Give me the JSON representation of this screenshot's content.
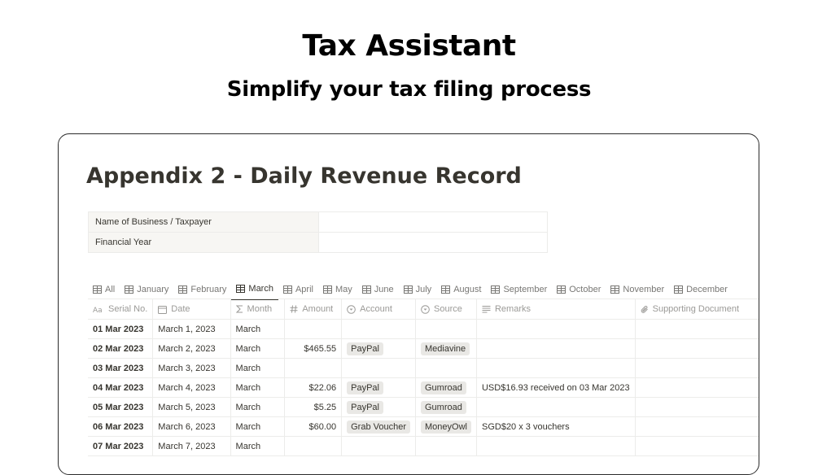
{
  "hero": {
    "title": "Tax Assistant",
    "subtitle": "Simplify your tax filing process"
  },
  "page": {
    "title": "Appendix 2 - Daily Revenue Record"
  },
  "info": [
    {
      "label": "Name of Business / Taxpayer",
      "value": ""
    },
    {
      "label": "Financial Year",
      "value": ""
    }
  ],
  "tabs": [
    {
      "label": "All",
      "icon": "table-icon",
      "active": false
    },
    {
      "label": "January",
      "icon": "table-icon",
      "active": false
    },
    {
      "label": "February",
      "icon": "table-icon",
      "active": false
    },
    {
      "label": "March",
      "icon": "table-icon",
      "active": true
    },
    {
      "label": "April",
      "icon": "table-icon",
      "active": false
    },
    {
      "label": "May",
      "icon": "table-icon",
      "active": false
    },
    {
      "label": "June",
      "icon": "table-icon",
      "active": false
    },
    {
      "label": "July",
      "icon": "table-icon",
      "active": false
    },
    {
      "label": "August",
      "icon": "table-icon",
      "active": false
    },
    {
      "label": "September",
      "icon": "table-icon",
      "active": false
    },
    {
      "label": "October",
      "icon": "table-icon",
      "active": false
    },
    {
      "label": "November",
      "icon": "table-icon",
      "active": false
    },
    {
      "label": "December",
      "icon": "table-icon",
      "active": false
    }
  ],
  "columns": [
    {
      "key": "serial",
      "label": "Serial No.",
      "icon": "text-icon"
    },
    {
      "key": "date",
      "label": "Date",
      "icon": "calendar-icon"
    },
    {
      "key": "month",
      "label": "Month",
      "icon": "sigma-icon"
    },
    {
      "key": "amount",
      "label": "Amount",
      "icon": "hash-icon"
    },
    {
      "key": "account",
      "label": "Account",
      "icon": "select-icon"
    },
    {
      "key": "source",
      "label": "Source",
      "icon": "select-icon"
    },
    {
      "key": "remarks",
      "label": "Remarks",
      "icon": "lines-icon"
    },
    {
      "key": "document",
      "label": "Supporting Document",
      "icon": "paperclip-icon"
    }
  ],
  "rows": [
    {
      "serial": "01 Mar 2023",
      "date": "March 1, 2023",
      "month": "March",
      "amount": "",
      "account": "",
      "source": "",
      "remarks": "",
      "document": ""
    },
    {
      "serial": "02 Mar 2023",
      "date": "March 2, 2023",
      "month": "March",
      "amount": "$465.55",
      "account": "PayPal",
      "source": "Mediavine",
      "remarks": "",
      "document": ""
    },
    {
      "serial": "03 Mar 2023",
      "date": "March 3, 2023",
      "month": "March",
      "amount": "",
      "account": "",
      "source": "",
      "remarks": "",
      "document": ""
    },
    {
      "serial": "04 Mar 2023",
      "date": "March 4, 2023",
      "month": "March",
      "amount": "$22.06",
      "account": "PayPal",
      "source": "Gumroad",
      "remarks": "USD$16.93 received on 03 Mar 2023",
      "document": ""
    },
    {
      "serial": "05 Mar 2023",
      "date": "March 5, 2023",
      "month": "March",
      "amount": "$5.25",
      "account": "PayPal",
      "source": "Gumroad",
      "remarks": "",
      "document": ""
    },
    {
      "serial": "06 Mar 2023",
      "date": "March 6, 2023",
      "month": "March",
      "amount": "$60.00",
      "account": "Grab Voucher",
      "source": "MoneyOwl",
      "remarks": "SGD$20 x 3 vouchers",
      "document": ""
    },
    {
      "serial": "07 Mar 2023",
      "date": "March 7, 2023",
      "month": "March",
      "amount": "",
      "account": "",
      "source": "",
      "remarks": "",
      "document": ""
    }
  ]
}
